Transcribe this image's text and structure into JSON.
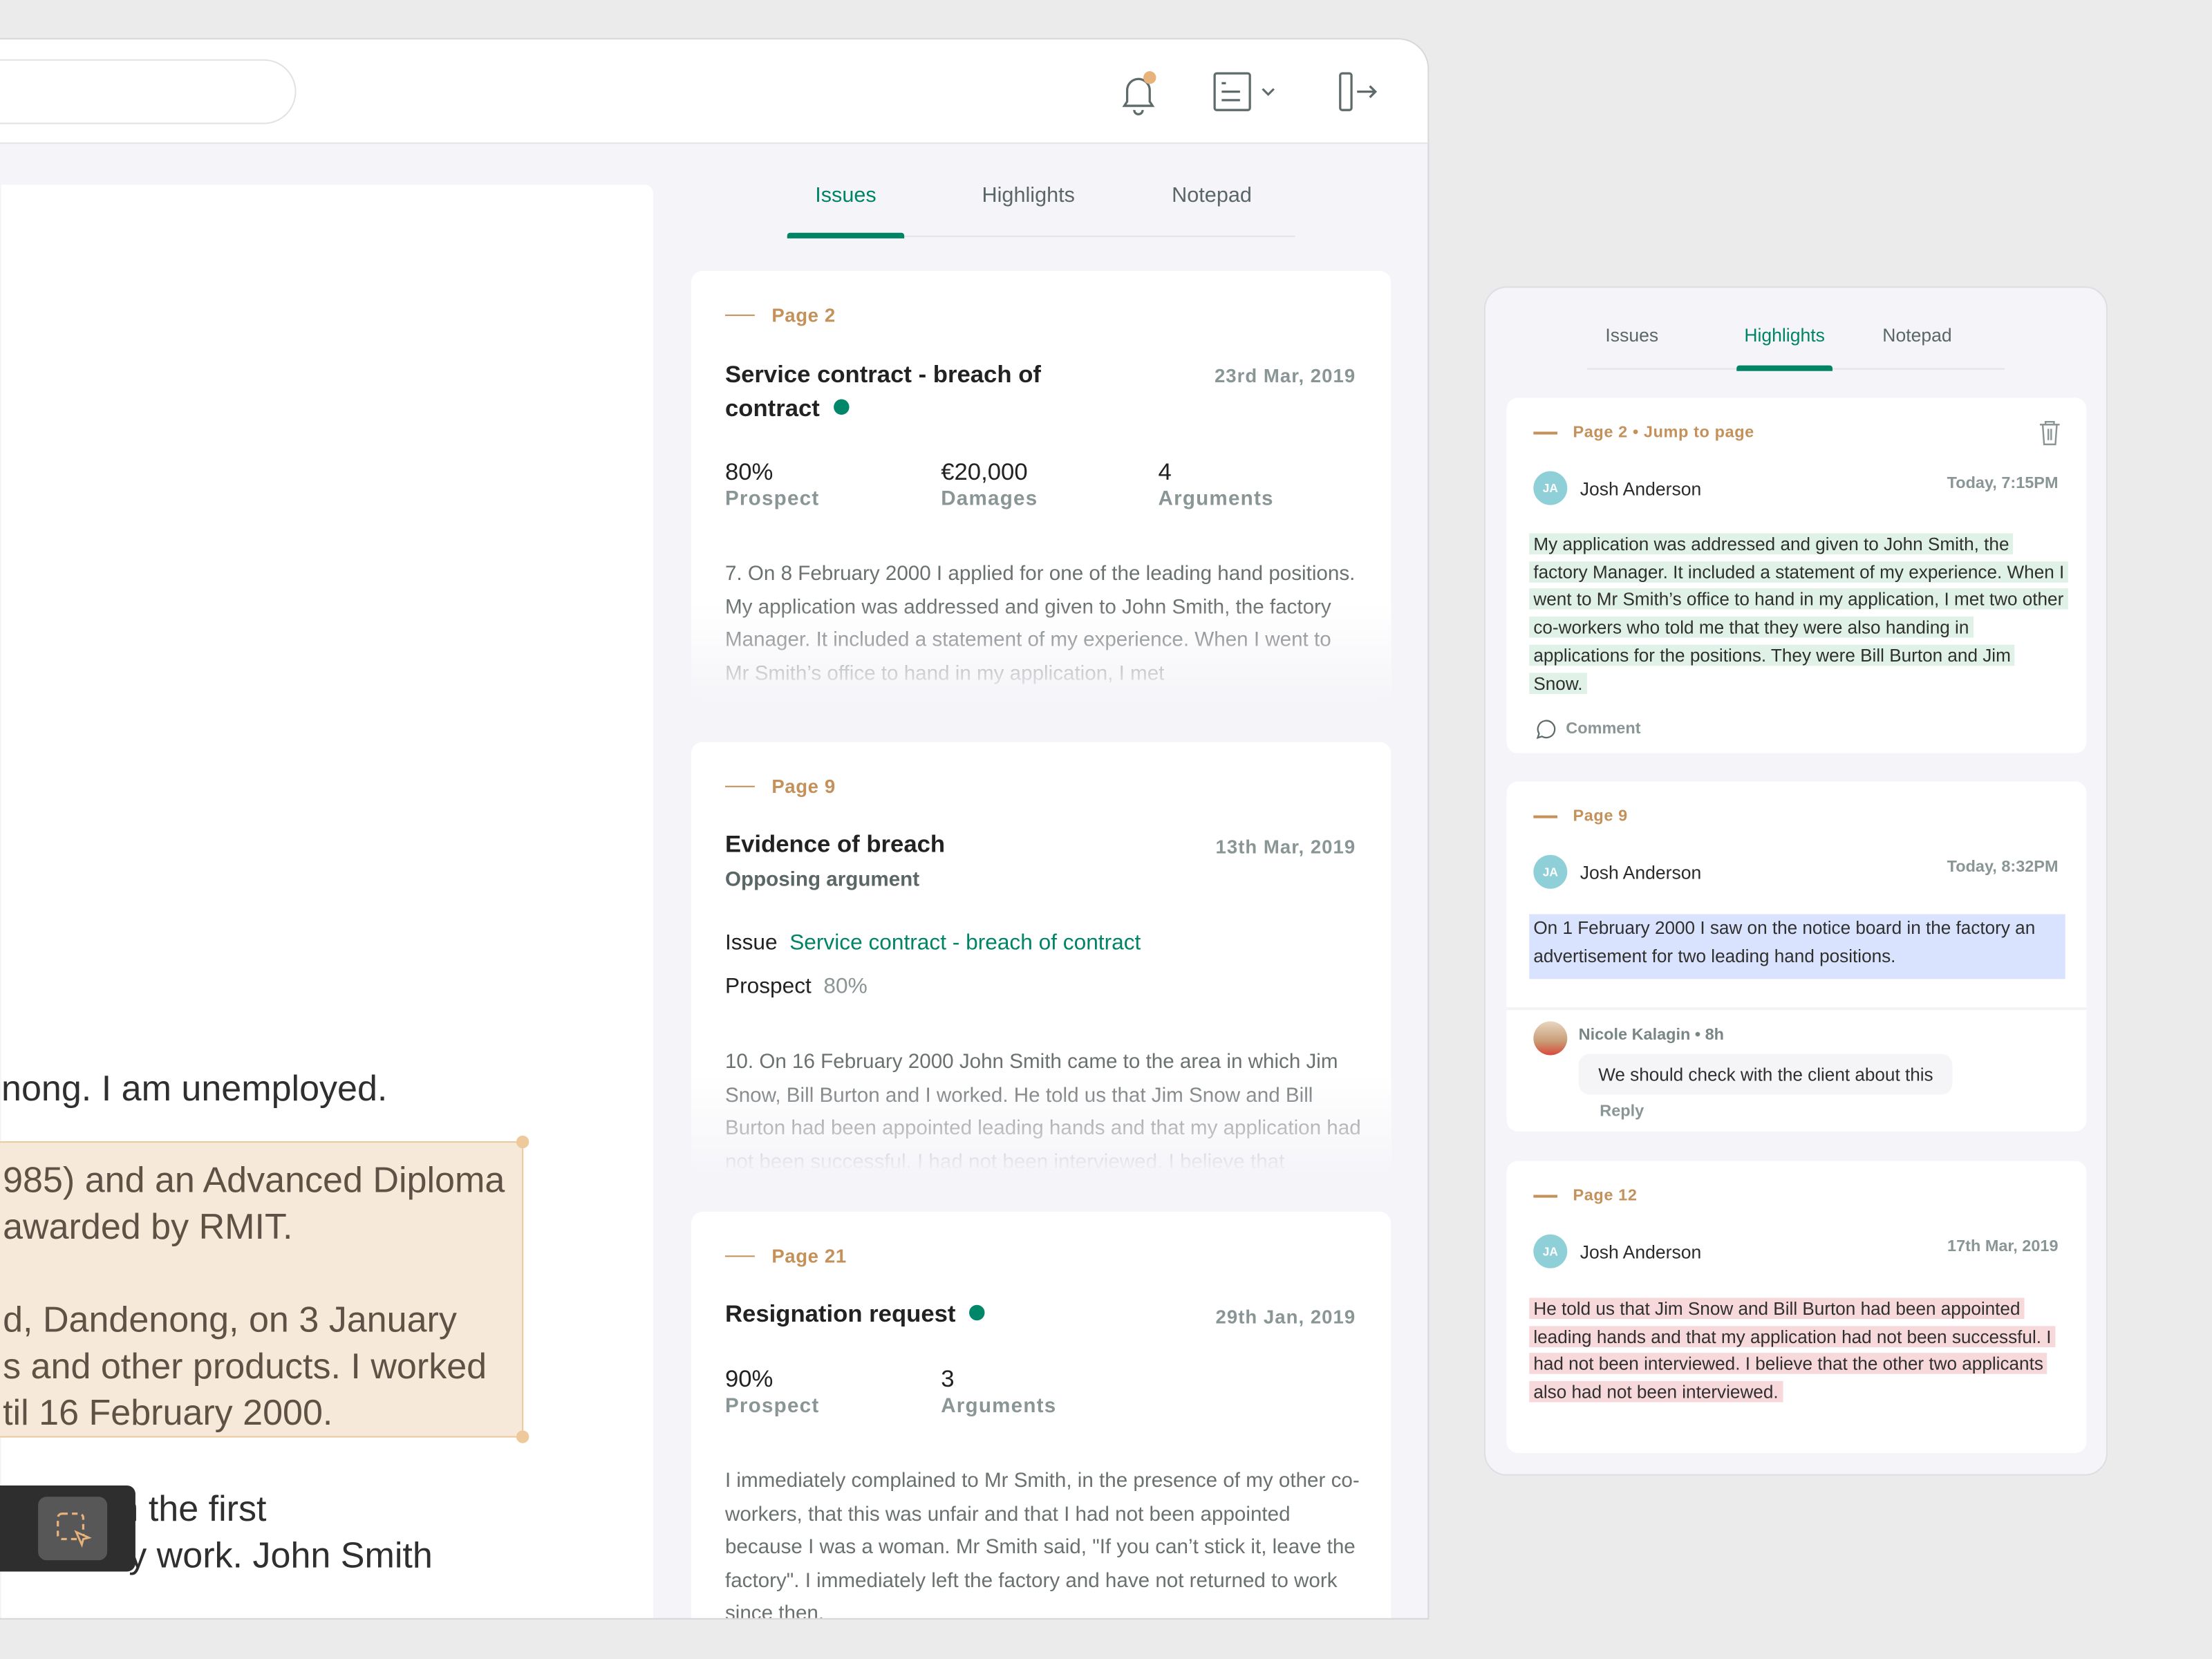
{
  "header": {
    "search_placeholder": "",
    "icons": [
      "bell-icon",
      "document-menu-icon",
      "chevron-down-icon",
      "logout-icon"
    ],
    "notification_dot_color": "#e8b27b"
  },
  "document": {
    "lines": [
      "nong. I am unemployed."
    ],
    "highlighted_lines": [
      "985) and an Advanced Diploma",
      "awarded by RMIT.",
      "",
      "d, Dandenong, on 3 January",
      "s and other products. I worked",
      "til 16 February 2000."
    ],
    "after_lines": [
      "h the first",
      "my work. John Smith"
    ],
    "highlight_color": "#f6e9da",
    "toolbar_icon": "select-area-icon"
  },
  "issues_panel": {
    "tabs": [
      {
        "label": "Issues",
        "active": true
      },
      {
        "label": "Highlights",
        "active": false
      },
      {
        "label": "Notepad",
        "active": false
      }
    ],
    "accent": "#008466",
    "cards": [
      {
        "page": "Page 2",
        "title": "Service contract - breach of contract",
        "date": "23rd Mar, 2019",
        "stats": [
          {
            "value": "80%",
            "label": "Prospect"
          },
          {
            "value": "€20,000",
            "label": "Damages"
          },
          {
            "value": "4",
            "label": "Arguments"
          }
        ],
        "text": "7. On 8 February 2000 I applied for one of the leading hand positions. My application was addressed and given to John Smith, the factory Manager. It included a statement of my experience. When I went to Mr Smith’s office to hand in my application, I met"
      },
      {
        "page": "Page 9",
        "title": "Evidence of breach",
        "subtitle": "Opposing argument",
        "issue_label": "Issue",
        "issue_link": "Service contract - breach of contract",
        "prospect_label": "Prospect",
        "prospect_value": "80%",
        "date": "13th Mar, 2019",
        "text": "10. On 16 February 2000 John Smith came to the area in which Jim Snow, Bill Burton and I worked. He told us that Jim Snow and Bill Burton had been appointed leading hands and that my application had not been successful. I had not been interviewed. I believe that"
      },
      {
        "page": "Page 21",
        "title": "Resignation request",
        "date": "29th Jan, 2019",
        "stats": [
          {
            "value": "90%",
            "label": "Prospect"
          },
          {
            "value": "3",
            "label": "Arguments"
          }
        ],
        "text": "I immediately complained to Mr Smith, in the presence of my other co-workers, that this was unfair and that I had not been appointed because I was a woman. Mr Smith said, \"If you can’t stick it, leave the factory\". I immediately left the factory and have not returned to work since then."
      }
    ]
  },
  "highlights_panel": {
    "tabs": [
      {
        "label": "Issues",
        "active": false
      },
      {
        "label": "Highlights",
        "active": true
      },
      {
        "label": "Notepad",
        "active": false
      }
    ],
    "cards": [
      {
        "page": "Page 2 • Jump to page",
        "author_initials": "JA",
        "author": "Josh Anderson",
        "time": "Today, 7:15PM",
        "text": "My application was addressed and given to John Smith, the factory Manager. It included a statement of my experience. When I went to Mr Smith’s office to hand in my application, I met two other co-workers who told me that they were also handing in applications for the positions. They were Bill Burton and Jim Snow.",
        "color": "#e0f2e7",
        "comment_label": "Comment"
      },
      {
        "page": "Page 9",
        "author_initials": "JA",
        "author": "Josh Anderson",
        "time": "Today, 8:32PM",
        "text": "On 1 February 2000 I saw on the notice board in the factory an advertisement for two leading hand positions.",
        "color": "#dae3fd",
        "reply": {
          "author": "Nicole Kalagin • 8h",
          "text": "We should check with the client about this",
          "reply_label": "Reply"
        }
      },
      {
        "page": "Page 12",
        "author_initials": "JA",
        "author": "Josh Anderson",
        "time": "17th Mar, 2019",
        "text": "He told us that Jim Snow and Bill Burton had been appointed leading hands and that my application had not been successful. I had not been interviewed. I believe that the other two applicants also had not been interviewed.",
        "color": "#f7d9dc"
      }
    ]
  }
}
